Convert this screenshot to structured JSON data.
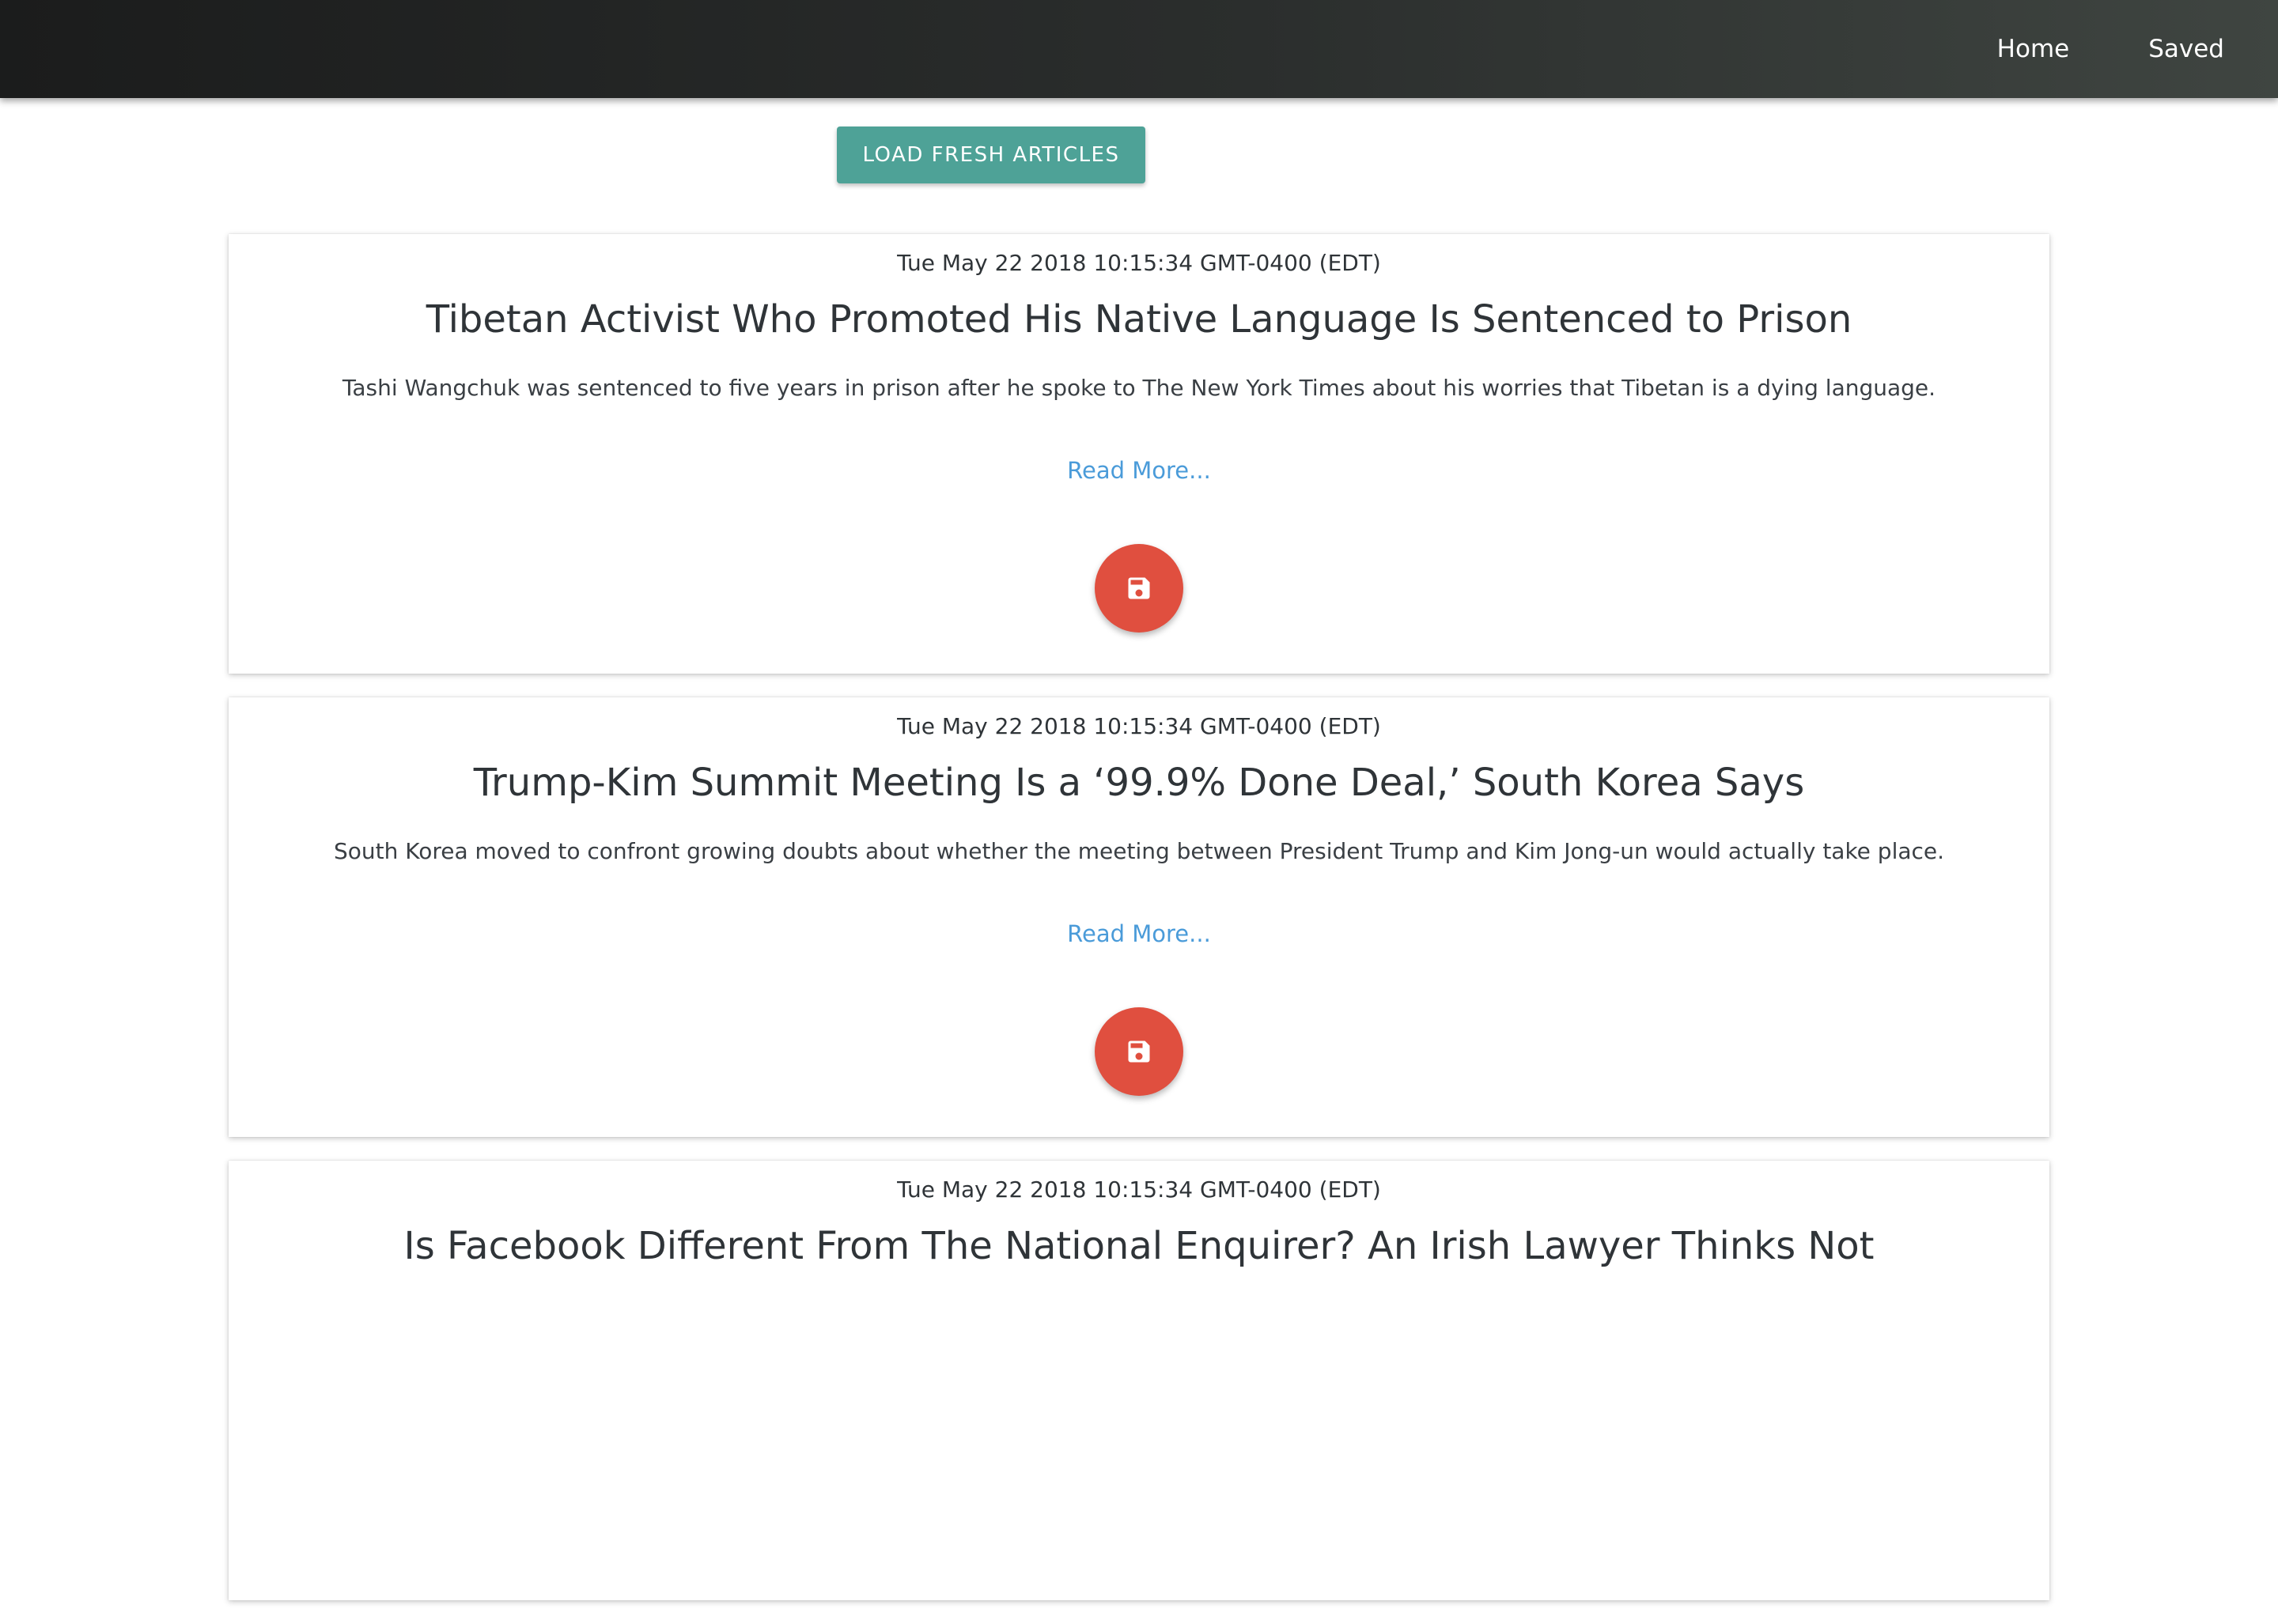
{
  "nav": {
    "links": [
      "Home",
      "Saved"
    ]
  },
  "toolbar": {
    "load_label": "LOAD FRESH ARTICLES"
  },
  "articles": [
    {
      "date": "Tue May 22 2018 10:15:34 GMT-0400 (EDT)",
      "title": "Tibetan Activist Who Promoted His Native Language Is Sentenced to Prison",
      "summary": "Tashi Wangchuk was sentenced to five years in prison after he spoke to The New York Times about his worries that Tibetan is a dying language.",
      "link_label": "Read More..."
    },
    {
      "date": "Tue May 22 2018 10:15:34 GMT-0400 (EDT)",
      "title": "Trump-Kim Summit Meeting Is a ‘99.9% Done Deal,’ South Korea Says",
      "summary": "South Korea moved to confront growing doubts about whether the meeting between President Trump and Kim Jong-un would actually take place.",
      "link_label": "Read More..."
    },
    {
      "date": "Tue May 22 2018 10:15:34 GMT-0400 (EDT)",
      "title": "Is Facebook Different From The National Enquirer? An Irish Lawyer Thinks Not",
      "summary": "",
      "link_label": ""
    }
  ],
  "icons": {
    "save": "floppy-disk-icon"
  },
  "colors": {
    "navbar": "#2b2e2d",
    "accent_teal": "#4ea297",
    "save_red": "#e04f3f",
    "link_blue": "#4a9bd9"
  }
}
